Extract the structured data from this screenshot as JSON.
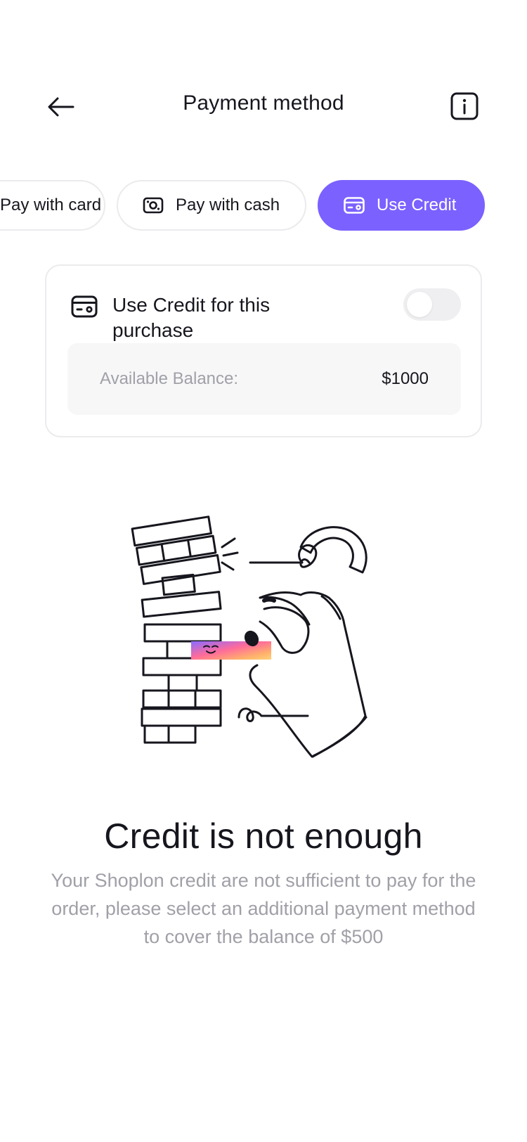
{
  "header": {
    "title": "Payment method",
    "back_icon": "arrow-left-icon",
    "info_icon": "info-icon"
  },
  "tabs": [
    {
      "label": "Pay with card",
      "icon": "card-icon",
      "active": false
    },
    {
      "label": "Pay with cash",
      "icon": "cash-icon",
      "active": false
    },
    {
      "label": "Use Credit",
      "icon": "credit-card-icon",
      "active": true
    }
  ],
  "credit_panel": {
    "label": "Use Credit for this purchase",
    "toggle_on": false,
    "balance_label": "Available Balance:",
    "balance_value": "$1000"
  },
  "message": {
    "title": "Credit is not enough",
    "body": "Your Shoplon credit are not sufficient to pay for the order, please select an additional payment method to cover the balance of $500"
  },
  "colors": {
    "accent": "#7b61ff",
    "text": "#16161e",
    "muted": "#a0a0a8",
    "border": "#ebebee",
    "surface": "#f7f7f8"
  }
}
